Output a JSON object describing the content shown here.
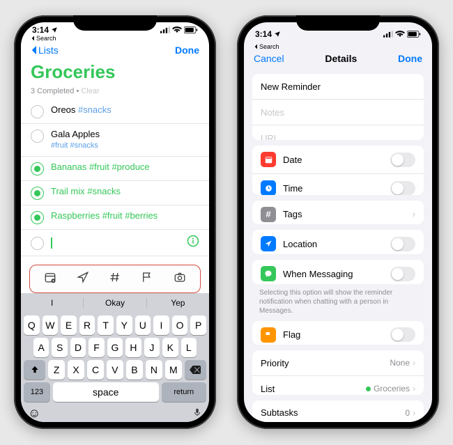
{
  "status": {
    "time": "3:14",
    "back_search": "Search"
  },
  "left": {
    "nav_back": "Lists",
    "nav_done": "Done",
    "title": "Groceries",
    "title_color": "#34c759",
    "completed_count": "3 Completed",
    "clear": "Clear",
    "items": [
      {
        "text": "Oreos",
        "tags": "#snacks",
        "done": false,
        "subline": ""
      },
      {
        "text": "Gala Apples",
        "tags": "",
        "done": false,
        "subline": "#fruit #snacks"
      },
      {
        "text": "Bananas",
        "tags": "#fruit #produce",
        "done": true,
        "subline": ""
      },
      {
        "text": "Trail mix",
        "tags": "#snacks",
        "done": true,
        "subline": ""
      },
      {
        "text": "Raspberries",
        "tags": "#fruit #berries",
        "done": true,
        "subline": ""
      }
    ],
    "quickbar": [
      "calendar-icon",
      "location-icon",
      "hashtag-icon",
      "flag-icon",
      "camera-icon"
    ],
    "predictions": [
      "I",
      "Okay",
      "Yep"
    ],
    "keyboard": {
      "row1": [
        "Q",
        "W",
        "E",
        "R",
        "T",
        "Y",
        "U",
        "I",
        "O",
        "P"
      ],
      "row2": [
        "A",
        "S",
        "D",
        "F",
        "G",
        "H",
        "J",
        "K",
        "L"
      ],
      "row3": [
        "Z",
        "X",
        "C",
        "V",
        "B",
        "N",
        "M"
      ],
      "numkey": "123",
      "space": "space",
      "return": "return"
    }
  },
  "right": {
    "nav_cancel": "Cancel",
    "nav_title": "Details",
    "nav_done": "Done",
    "title_field": "New Reminder",
    "notes_placeholder": "Notes",
    "url_placeholder": "URL",
    "rows": {
      "date": "Date",
      "time": "Time",
      "tags": "Tags",
      "location": "Location",
      "messaging": "When Messaging",
      "messaging_note": "Selecting this option will show the reminder notification when chatting with a person in Messages.",
      "flag": "Flag",
      "priority": "Priority",
      "priority_value": "None",
      "list": "List",
      "list_value": "Groceries",
      "subtasks": "Subtasks",
      "subtasks_value": "0"
    }
  }
}
